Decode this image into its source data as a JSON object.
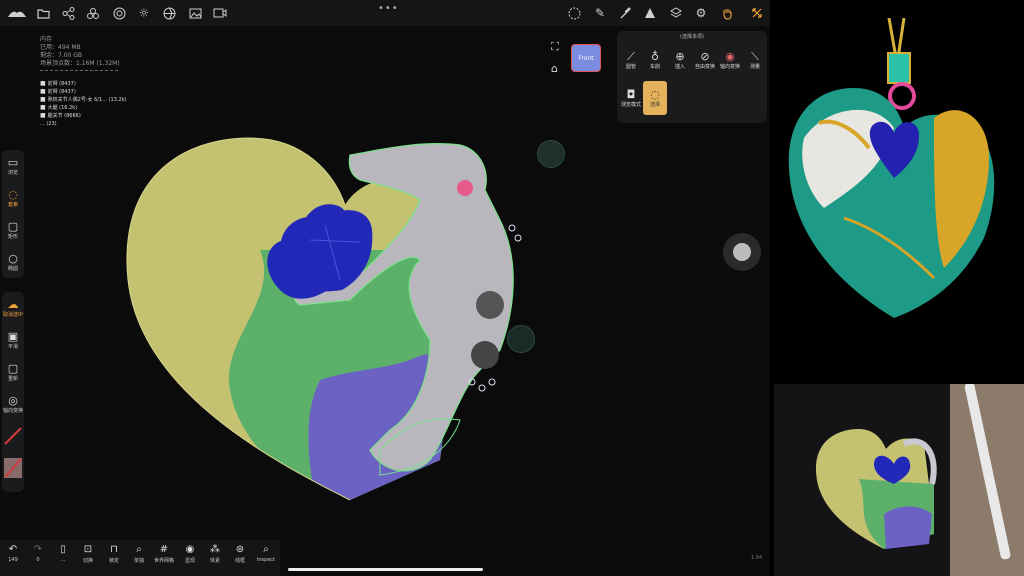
{
  "topbar": {
    "icons": [
      "logo-icon",
      "folder-icon",
      "share-icon",
      "layers-icon",
      "material-icon",
      "light-icon",
      "aperture-icon",
      "image-icon",
      "video-icon"
    ],
    "right_icons": [
      "select-icon",
      "pen-icon",
      "brush-icon",
      "triangle-icon",
      "stack-icon",
      "settings-icon",
      "hand-icon",
      "collapse-icon"
    ],
    "center_dots": "•••"
  },
  "info": {
    "memory_label": "内存",
    "used": "已用：494 MB",
    "remaining": "剩余：7.00 GB",
    "vertices": "场景顶点数：1.16M (1.32M)"
  },
  "layers": [
    {
      "name": "前臂 (8437)"
    },
    {
      "name": "前臂 (8437)"
    },
    {
      "name": "熟权关节人偶2号-女  6/1... (13.2k)"
    },
    {
      "name": "大腿 (16.2k)"
    },
    {
      "name": "腿关节 (8666)"
    },
    {
      "name": "... (23)"
    }
  ],
  "view": {
    "front_label": "Front"
  },
  "leftbar_top": [
    {
      "icon": "camera-icon",
      "label": "浏览"
    },
    {
      "icon": "lasso-icon",
      "label": "套索",
      "active": true
    },
    {
      "icon": "rect-icon",
      "label": "矩形"
    },
    {
      "icon": "ellipse-icon",
      "label": "椭圆"
    }
  ],
  "leftbar_bottom": [
    {
      "icon": "cloud-icon",
      "label": "取消选中",
      "active": true
    },
    {
      "icon": "smooth-icon",
      "label": "平滑"
    },
    {
      "icon": "hide-icon",
      "label": "重新"
    },
    {
      "icon": "axis-icon",
      "label": "轴向变换"
    }
  ],
  "panel": {
    "title": "(选择多项)",
    "tools_row1": [
      {
        "icon": "curve-icon",
        "label": "圆管"
      },
      {
        "icon": "ring-icon",
        "label": "车削"
      },
      {
        "icon": "insert-icon",
        "label": "插入"
      },
      {
        "icon": "free-transform-icon",
        "label": "自由变换"
      },
      {
        "icon": "axis-transform-icon",
        "label": "轴向变换"
      },
      {
        "icon": "ruler-icon",
        "label": "测量"
      }
    ],
    "tools_row2": [
      {
        "icon": "camera-icon",
        "label": "测览模式"
      },
      {
        "icon": "select-icon",
        "label": "选择",
        "selected": true
      }
    ]
  },
  "bottombar": [
    {
      "icon": "undo-icon",
      "label": "149"
    },
    {
      "icon": "redo-icon",
      "label": "0"
    },
    {
      "icon": "phone-icon",
      "label": "..."
    },
    {
      "icon": "switch-icon",
      "label": "切换"
    },
    {
      "icon": "lock-icon",
      "label": "锁定"
    },
    {
      "icon": "search-icon",
      "label": "单独"
    },
    {
      "icon": "grid-icon",
      "label": "世界网格"
    },
    {
      "icon": "eye-icon",
      "label": "显现"
    },
    {
      "icon": "body-icon",
      "label": "体素"
    },
    {
      "icon": "wireframe-icon",
      "label": "线框"
    },
    {
      "icon": "inspect-icon",
      "label": "Inspect"
    }
  ],
  "fps": "1.84",
  "colors": {
    "accent": "#f2a23a",
    "select_bg": "#e4b25a",
    "panel": "#1b1b1d",
    "heart_yellow": "#c4c271",
    "heart_green": "#5db06a",
    "heart_purple": "#6c62c4",
    "gem_blue": "#2229b8"
  }
}
